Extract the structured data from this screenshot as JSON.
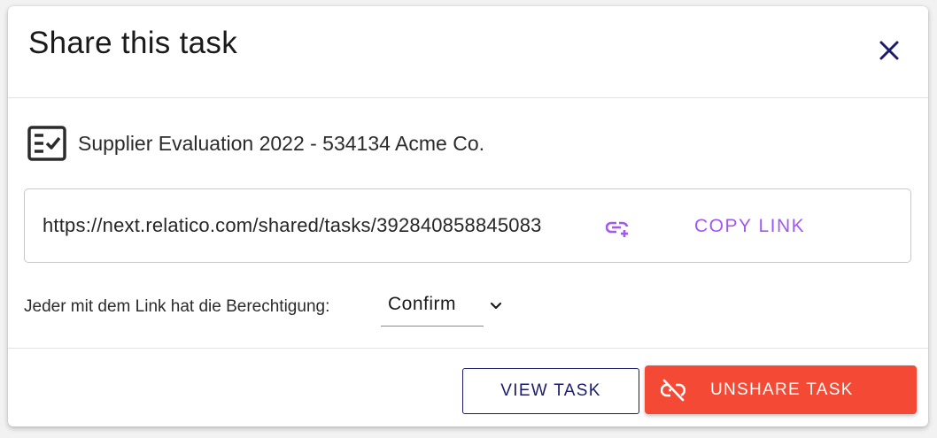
{
  "dialog": {
    "title": "Share this task",
    "close_icon": "close-icon"
  },
  "task": {
    "icon": "task-checklist-icon",
    "name": "Supplier Evaluation 2022 - 534134 Acme Co."
  },
  "share_link": {
    "url": "https://next.relatico.com/shared/tasks/392840858845083",
    "link_icon": "link-add-icon",
    "copy_label": "COPY LINK"
  },
  "permission": {
    "label": "Jeder mit dem Link hat die Berechtigung:",
    "selected": "Confirm",
    "chevron_icon": "chevron-down-icon"
  },
  "actions": {
    "view_label": "VIEW TASK",
    "unshare_label": "UNSHARE TASK",
    "unshare_icon": "link-off-icon"
  },
  "colors": {
    "accent_purple": "#a259f0",
    "navy": "#1c1c6e",
    "danger": "#f44a35"
  }
}
